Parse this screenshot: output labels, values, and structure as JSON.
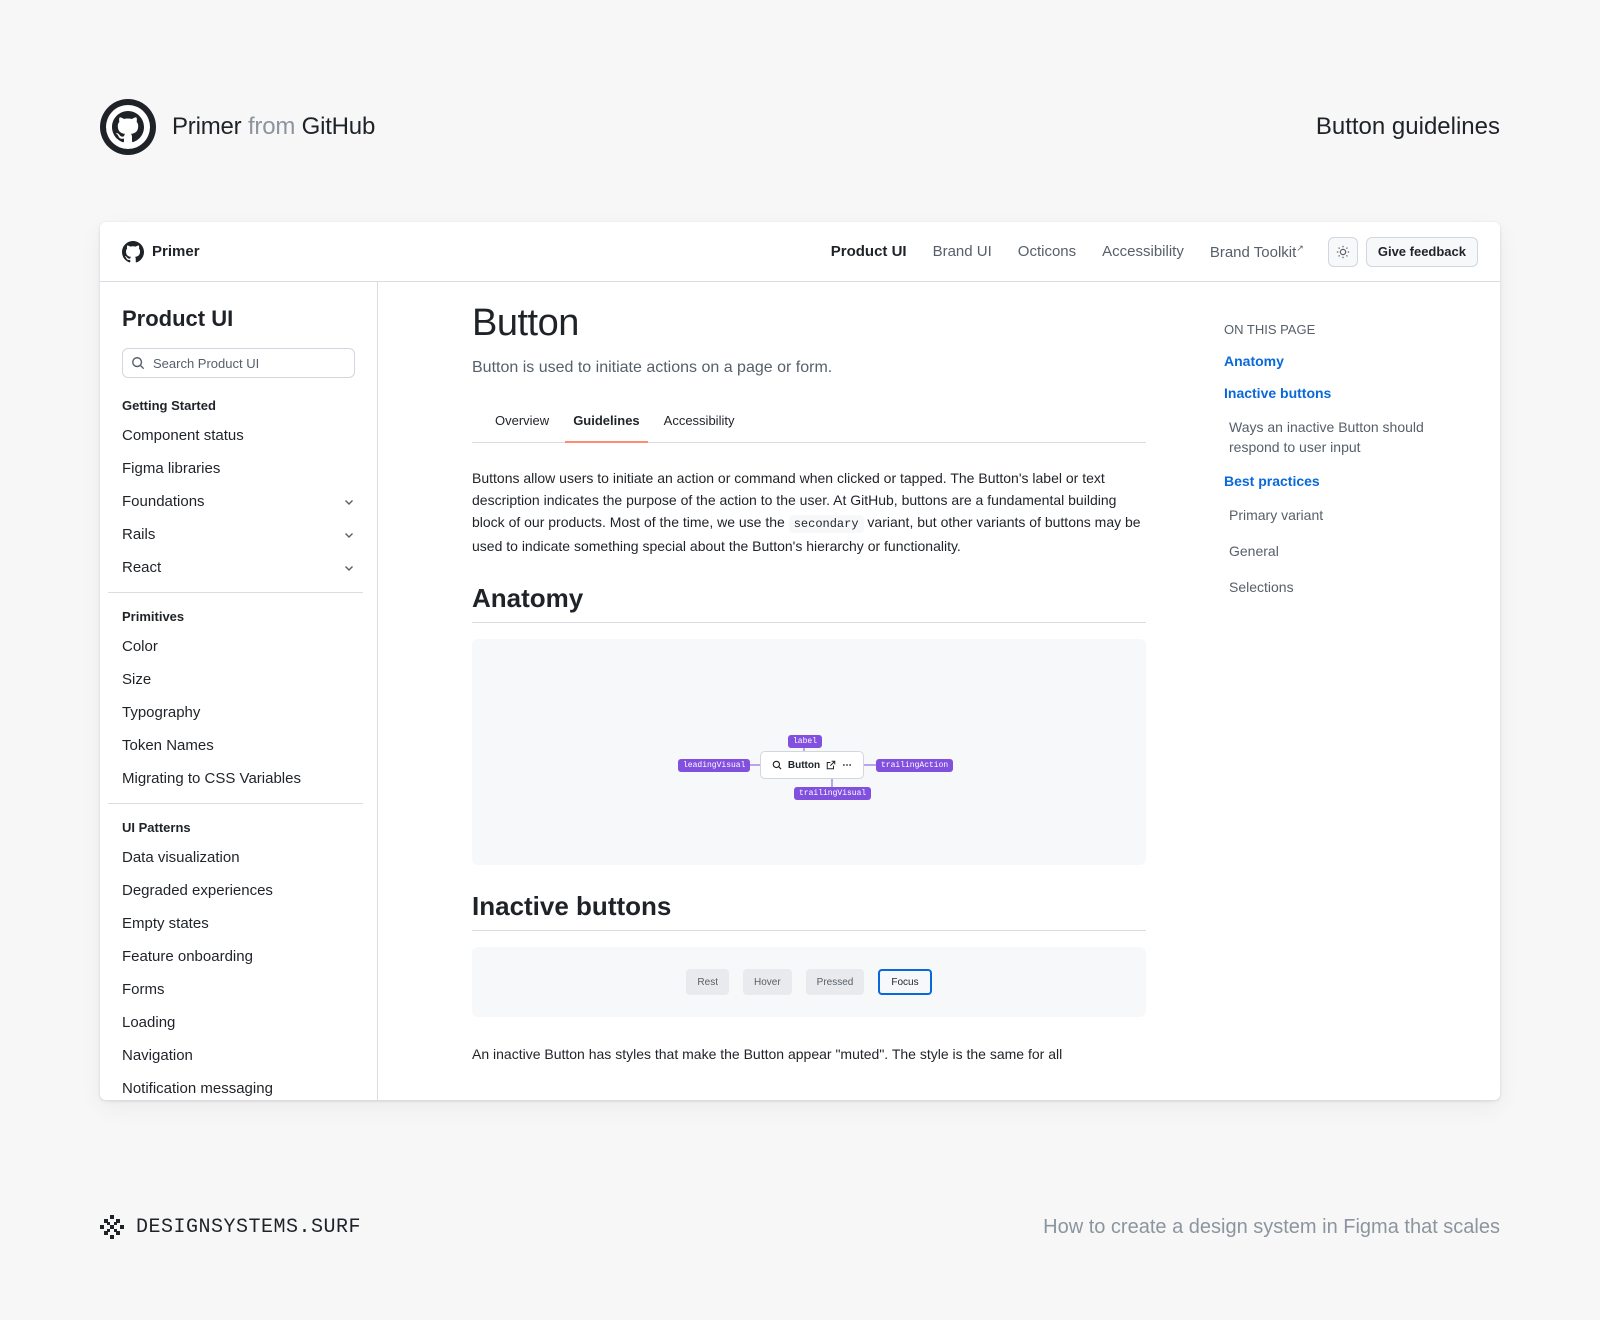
{
  "outer": {
    "brand_primary": "Primer",
    "brand_from": "from",
    "brand_github": "GitHub",
    "page_label": "Button guidelines"
  },
  "topnav": {
    "logo_text": "Primer",
    "links": [
      "Product UI",
      "Brand UI",
      "Octicons",
      "Accessibility",
      "Brand Toolkit"
    ],
    "external_mark": "↗",
    "feedback": "Give feedback"
  },
  "sidebar": {
    "title": "Product UI",
    "search_placeholder": "Search Product UI",
    "getting_started": "Getting Started",
    "items1": [
      "Component status",
      "Figma libraries",
      "Foundations",
      "Rails",
      "React"
    ],
    "primitives": "Primitives",
    "items2": [
      "Color",
      "Size",
      "Typography",
      "Token Names",
      "Migrating to CSS Variables"
    ],
    "ui_patterns": "UI Patterns",
    "items3": [
      "Data visualization",
      "Degraded experiences",
      "Empty states",
      "Feature onboarding",
      "Forms",
      "Loading",
      "Navigation",
      "Notification messaging"
    ]
  },
  "main": {
    "title": "Button",
    "lede": "Button is used to initiate actions on a page or form.",
    "tabs": [
      "Overview",
      "Guidelines",
      "Accessibility"
    ],
    "intro_a": "Buttons allow users to initiate an action or command when clicked or tapped. The Button's label or text description indicates the purpose of the action to the user. At GitHub, buttons are a fundamental building block of our products. Most of the time, we use the ",
    "intro_code": "secondary",
    "intro_b": " variant, but other variants of buttons may be used to indicate something special about the Button's hierarchy or functionality.",
    "anatomy_heading": "Anatomy",
    "anatomy": {
      "button_label": "Button",
      "tag_label": "label",
      "tag_leading": "leadingVisual",
      "tag_trailing_action": "trailingAction",
      "tag_trailing_visual": "trailingVisual"
    },
    "inactive_heading": "Inactive buttons",
    "states": [
      "Rest",
      "Hover",
      "Pressed",
      "Focus"
    ],
    "inactive_text": "An inactive Button has styles that make the Button appear \"muted\". The style is the same for all"
  },
  "toc": {
    "head": "ON THIS PAGE",
    "anatomy": "Anatomy",
    "inactive": "Inactive buttons",
    "inactive_sub": "Ways an inactive Button should respond to user input",
    "best": "Best practices",
    "best_subs": [
      "Primary variant",
      "General",
      "Selections"
    ]
  },
  "footer": {
    "left": "DESIGNSYSTEMS.SURF",
    "right": "How to create a design system in Figma that scales"
  },
  "colors": {
    "link": "#0969da",
    "tab_underline": "#fd8c73",
    "anatomy_tag": "#8250df",
    "focus_ring": "#0969da"
  }
}
